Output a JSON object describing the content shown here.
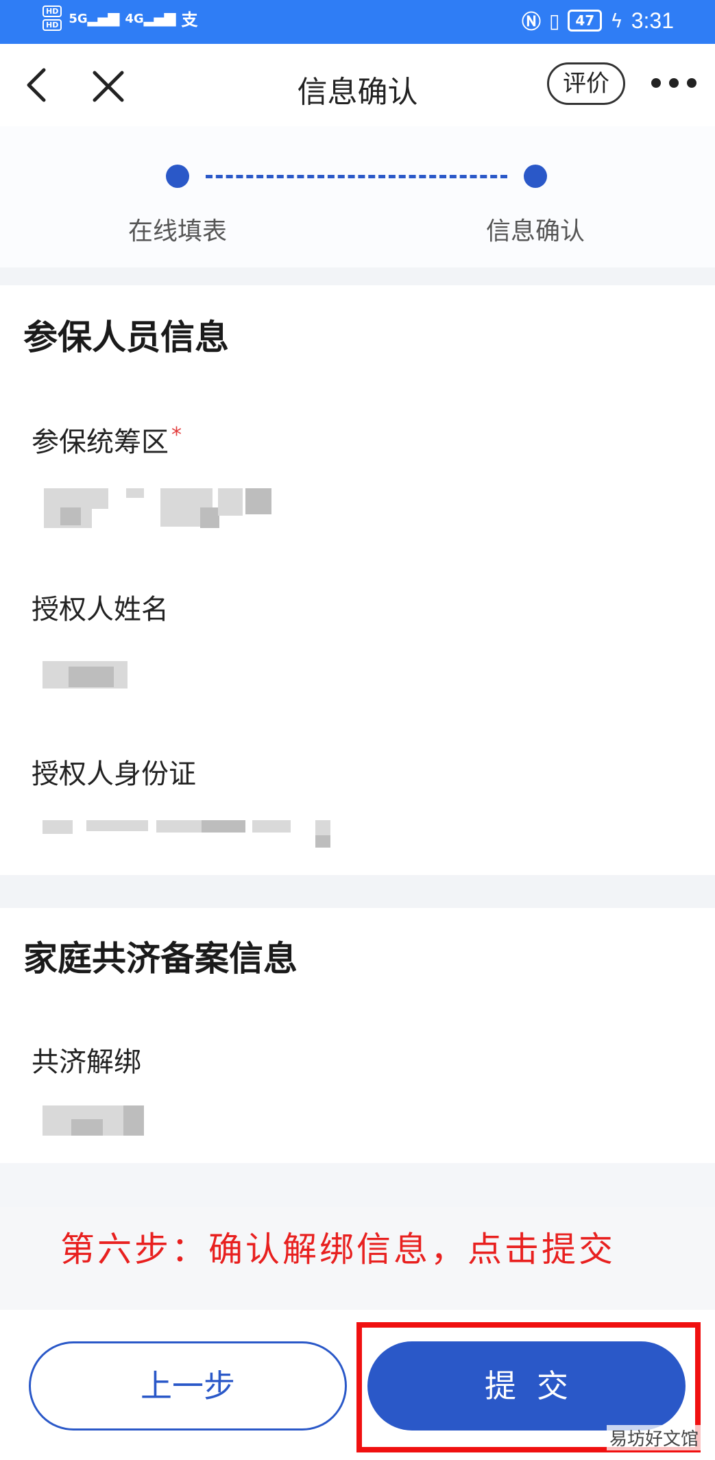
{
  "status_bar": {
    "hd1": "HD",
    "hd2": "HD",
    "network1": "5G",
    "network2": "4G",
    "battery": "47",
    "time": "3:31"
  },
  "nav": {
    "title": "信息确认",
    "evaluate_label": "评价"
  },
  "steps": [
    {
      "label": "在线填表"
    },
    {
      "label": "信息确认"
    }
  ],
  "insured_section": {
    "title": "参保人员信息",
    "fields": [
      {
        "label": "参保统筹区",
        "required_mark": "*"
      },
      {
        "label": "授权人姓名"
      },
      {
        "label": "授权人身份证"
      }
    ]
  },
  "family_section": {
    "title": "家庭共济备案信息",
    "fields": [
      {
        "label": "共济解绑"
      }
    ]
  },
  "annotation": "第六步：确认解绑信息，点击提交",
  "buttons": {
    "prev_label": "上一步",
    "submit_label": "提交"
  },
  "watermark": "易坊好文馆",
  "colors": {
    "status_bar": "#2f7df5",
    "primary": "#2a58c8",
    "annotation": "#e8201f",
    "highlight": "#f01010"
  }
}
